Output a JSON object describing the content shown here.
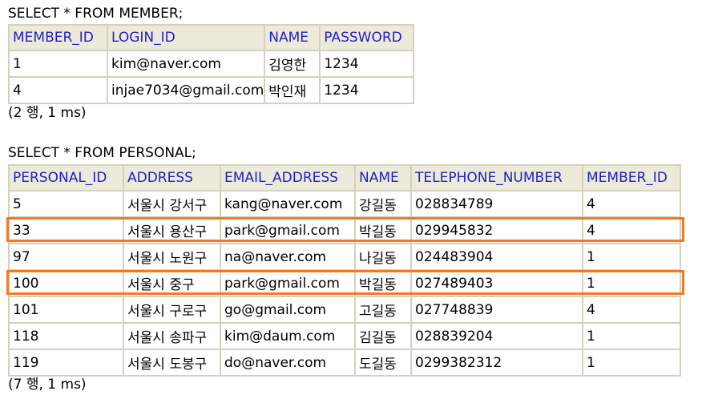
{
  "member": {
    "query": "SELECT * FROM MEMBER;",
    "columns": [
      "MEMBER_ID",
      "LOGIN_ID",
      "NAME",
      "PASSWORD"
    ],
    "rows": [
      [
        "1",
        "kim@naver.com",
        "김영한",
        "1234"
      ],
      [
        "4",
        "injae7034@gmail.com",
        "박인재",
        "1234"
      ]
    ],
    "status": "(2 행, 1 ms)"
  },
  "personal": {
    "query": "SELECT * FROM PERSONAL;",
    "columns": [
      "PERSONAL_ID",
      "ADDRESS",
      "EMAIL_ADDRESS",
      "NAME",
      "TELEPHONE_NUMBER",
      "MEMBER_ID"
    ],
    "rows": [
      [
        "5",
        "서울시 강서구",
        "kang@naver.com",
        "강길동",
        "028834789",
        "4"
      ],
      [
        "33",
        "서울시 용산구",
        "park@gmail.com",
        "박길동",
        "029945832",
        "4"
      ],
      [
        "97",
        "서울시 노원구",
        "na@naver.com",
        "나길동",
        "024483904",
        "1"
      ],
      [
        "100",
        "서울시 중구",
        "park@gmail.com",
        "박길동",
        "027489403",
        "1"
      ],
      [
        "101",
        "서울시 구로구",
        "go@gmail.com",
        "고길동",
        "027748839",
        "4"
      ],
      [
        "118",
        "서울시 송파구",
        "kim@daum.com",
        "김길동",
        "028839204",
        "1"
      ],
      [
        "119",
        "서울시 도봉구",
        "do@naver.com",
        "도길동",
        "0299382312",
        "1"
      ]
    ],
    "status": "(7 행, 1 ms)"
  },
  "highlight_color": "#f27b21",
  "highlighted_personal_rows": [
    1,
    3
  ]
}
